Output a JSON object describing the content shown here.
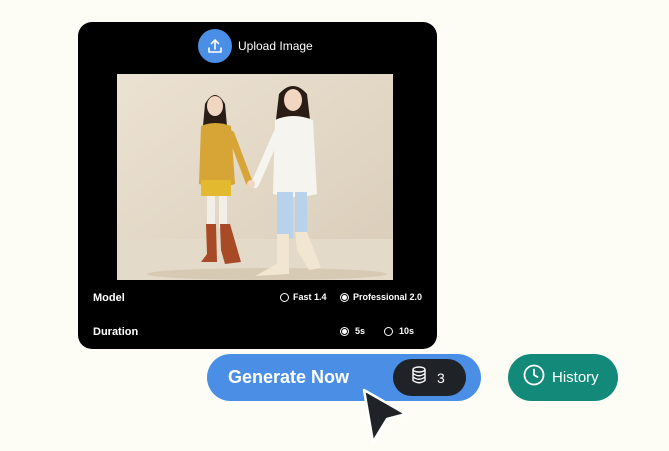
{
  "upload": {
    "label": "Upload Image",
    "icon": "upload-icon"
  },
  "settings": {
    "model_label": "Model",
    "model_options": [
      {
        "label": "Fast 1.4",
        "selected": false
      },
      {
        "label": "Professional 2.0",
        "selected": true
      }
    ],
    "duration_label": "Duration",
    "duration_options": [
      {
        "label": "5s",
        "selected": true
      },
      {
        "label": "10s",
        "selected": false
      }
    ]
  },
  "generate": {
    "label": "Generate Now",
    "credits": "3",
    "icon": "database-icon"
  },
  "history": {
    "label": "History",
    "icon": "clock-icon"
  },
  "colors": {
    "accent": "#4a8ee6",
    "history": "#13897a",
    "card": "#000000",
    "background": "#fdfcf5"
  }
}
